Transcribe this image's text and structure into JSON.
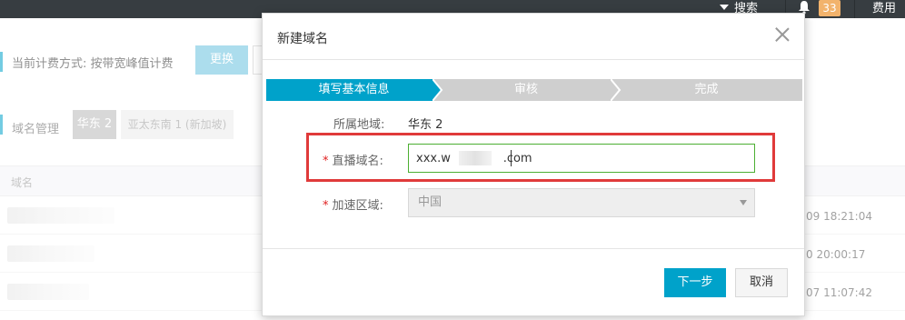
{
  "topbar": {
    "search_label": "搜索",
    "notification_count": "33",
    "fee_label": "费用",
    "background_color": "#373d41",
    "badge_color": "#f2b36c"
  },
  "page": {
    "billing_label": "当前计费方式: 按带宽峰值计费",
    "change_button": "更换",
    "domain_manage_label": "域名管理",
    "region_tabs": [
      {
        "label": "华东 2",
        "active": true
      },
      {
        "label": "亚太东南 1 (新加坡)",
        "active": false
      }
    ],
    "table": {
      "column_domain": "域名",
      "rows": [
        {
          "time": "09 18:21:04"
        },
        {
          "time": "0 20:00:17"
        },
        {
          "time": "07 11:07:42"
        }
      ]
    }
  },
  "modal": {
    "title": "新建域名",
    "steps": [
      {
        "label": "填写基本信息",
        "active": true
      },
      {
        "label": "审核",
        "active": false
      },
      {
        "label": "完成",
        "active": false
      }
    ],
    "region_label": "所属地域:",
    "region_value": "华东 2",
    "domain_label": "直播域名:",
    "domain_required": "*",
    "domain_value": "xxx.w              .com",
    "accel_label": "加速区域:",
    "accel_required": "*",
    "accel_value": "中国",
    "next_button": "下一步",
    "cancel_button": "取消",
    "accent_color": "#00a2ca",
    "highlight_color": "#e03a3a"
  }
}
